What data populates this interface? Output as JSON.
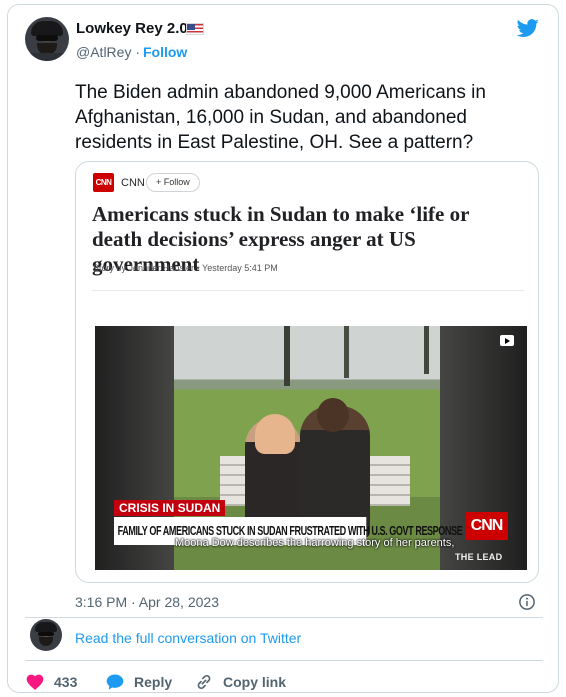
{
  "tweet": {
    "author_name": "Lowkey Rey 2.0",
    "handle": "@AtlRey",
    "separator": "·",
    "follow_label": "Follow",
    "text": "The Biden admin abandoned 9,000 Americans in Afghanistan, 16,000 in Sudan, and abandoned residents in East Palestine, OH. See a pattern?",
    "timestamp": "3:16 PM · Apr 28, 2023",
    "read_more_label": "Read the full conversation on Twitter",
    "icons": {
      "brand": "twitter-bird-icon",
      "flag": "us-flag-icon",
      "info": "info-icon",
      "like": "heart-icon",
      "reply": "reply-bubble-icon",
      "copy": "link-icon"
    },
    "colors": {
      "accent": "#1d9bf0",
      "like": "#f91880",
      "text": "#0f1419",
      "secondary": "#536471"
    }
  },
  "embed": {
    "source_logo": "CNN",
    "source_name": "CNN",
    "follow_label": "+  Follow",
    "headline": "Americans stuck in Sudan to make ‘life or death decisions’ express anger at US government",
    "byline": "Story by Jennifer Hansler • Yesterday 5:41 PM",
    "video": {
      "label_tag": "CRISIS IN SUDAN",
      "chyron": "FAMILY OF AMERICANS STUCK IN SUDAN FRUSTRATED WITH U.S. GOVT RESPONSE",
      "network_badge": "CNN",
      "subtitle": "Moona Dow describes the harrowing story of her parents,",
      "show_name": "THE LEAD"
    }
  },
  "actions": {
    "like_count": "433",
    "reply_label": "Reply",
    "copy_label": "Copy link"
  }
}
